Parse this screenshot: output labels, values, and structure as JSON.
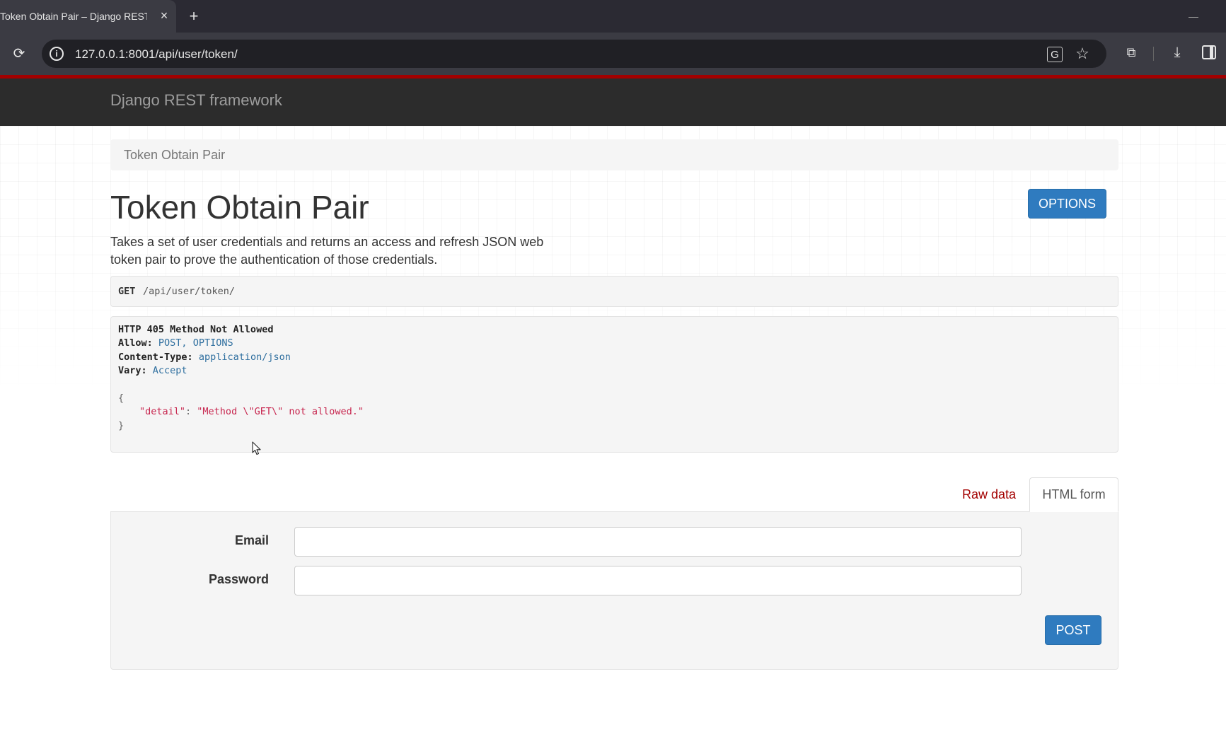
{
  "browser": {
    "tab_title": "Token Obtain Pair – Django REST framework",
    "tab_close": "×",
    "new_tab": "+",
    "url": "127.0.0.1:8001/api/user/token/"
  },
  "navbar": {
    "brand": "Django REST framework"
  },
  "breadcrumb": {
    "items": [
      "Token Obtain Pair"
    ]
  },
  "content": {
    "title": "Token Obtain Pair",
    "description": "Takes a set of user credentials and returns an access and refresh JSON web token pair to prove the authentication of those credentials.",
    "options_button": "OPTIONS"
  },
  "request": {
    "method": "GET",
    "path": "/api/user/token/"
  },
  "response": {
    "status": "HTTP 405 Method Not Allowed",
    "headers": [
      {
        "key": "Allow:",
        "value": "POST, OPTIONS"
      },
      {
        "key": "Content-Type:",
        "value": "application/json"
      },
      {
        "key": "Vary:",
        "value": "Accept"
      }
    ],
    "body_open": "{",
    "body_key": "\"detail\"",
    "body_sep": ": ",
    "body_value": "\"Method \\\"GET\\\" not allowed.\"",
    "body_close": "}"
  },
  "form_tabs": {
    "raw": "Raw data",
    "html": "HTML form",
    "active": "HTML form"
  },
  "form": {
    "fields": [
      {
        "label": "Email",
        "value": "",
        "placeholder": ""
      },
      {
        "label": "Password",
        "value": "",
        "placeholder": ""
      }
    ],
    "submit": "POST"
  },
  "colors": {
    "accent": "#a30000",
    "primary_button": "#2f7bbf",
    "navbar": "#2c2c2c",
    "header_value": "#2f6f9f",
    "json_string": "#c7254e"
  },
  "icons": {
    "reload": "reload-icon",
    "site_info": "info-icon",
    "translate": "translate-icon",
    "bookmark": "star-icon",
    "extensions": "extension-icon",
    "downloads": "download-icon",
    "side_panel": "side-panel-icon",
    "cursor": "mouse-cursor-icon"
  }
}
